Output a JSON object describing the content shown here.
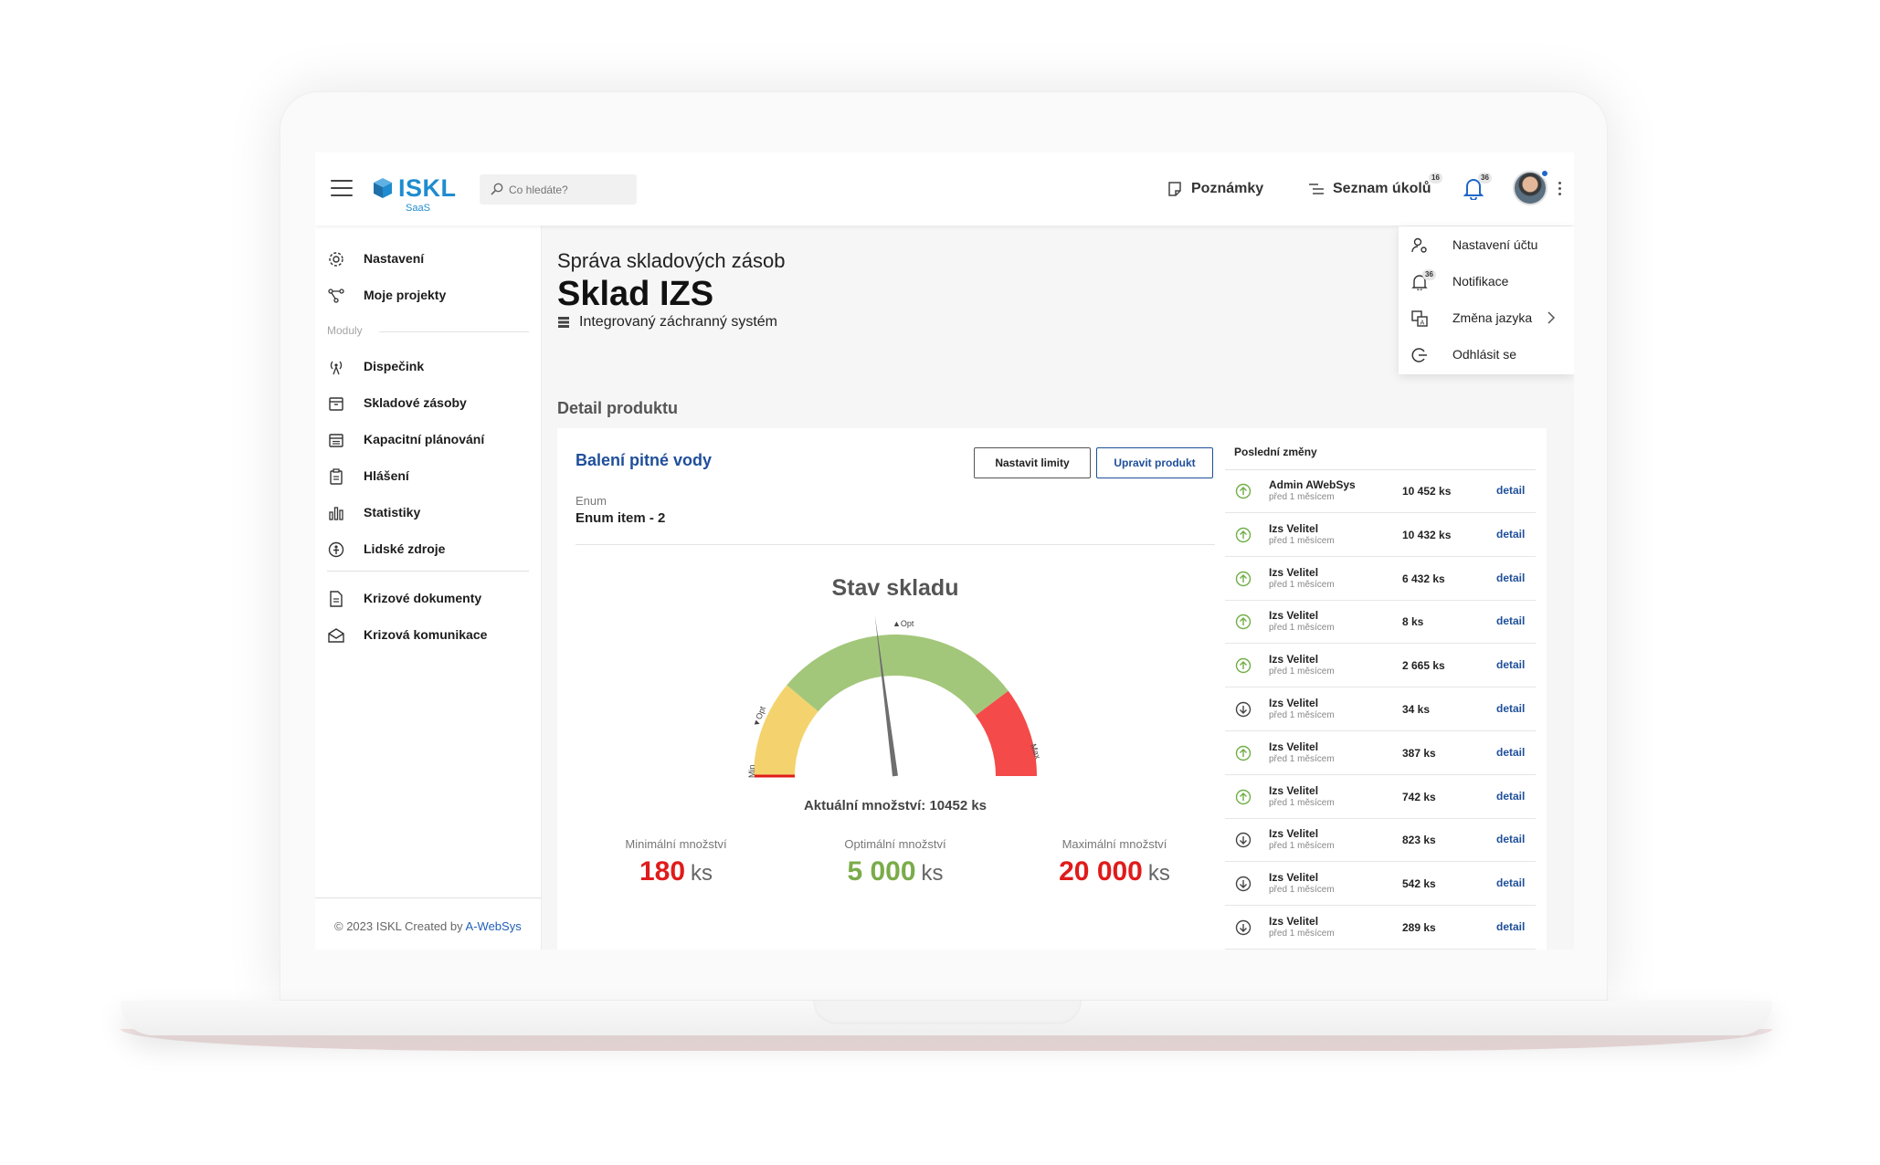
{
  "app": {
    "logo_text": "ISKL",
    "logo_sub": "SaaS",
    "brand_color": "#1f8ccf"
  },
  "search": {
    "placeholder": "Co hledáte?"
  },
  "header": {
    "notes_label": "Poznámky",
    "tasks_label": "Seznam úkolů",
    "tasks_count": "16",
    "notifications_count": "36"
  },
  "user_menu": {
    "items": [
      {
        "label": "Nastavení účtu",
        "icon": "user-settings-icon"
      },
      {
        "label": "Notifikace",
        "icon": "bell-icon",
        "badge": "36"
      },
      {
        "label": "Změna jazyka",
        "icon": "translate-icon"
      },
      {
        "label": "Odhlásit se",
        "icon": "logout-icon"
      }
    ]
  },
  "sidebar": {
    "top_items": [
      {
        "label": "Nastavení",
        "icon": "gear-icon"
      },
      {
        "label": "Moje projekty",
        "icon": "project-icon"
      }
    ],
    "section_label": "Moduly",
    "module_items": [
      {
        "label": "Dispečink",
        "icon": "antenna-icon"
      },
      {
        "label": "Skladové zásoby",
        "icon": "box-icon"
      },
      {
        "label": "Kapacitní plánování",
        "icon": "calendar-icon"
      },
      {
        "label": "Hlášení",
        "icon": "clipboard-icon"
      },
      {
        "label": "Statistiky",
        "icon": "bar-chart-icon"
      },
      {
        "label": "Lidské zdroje",
        "icon": "person-circle-icon"
      }
    ],
    "bottom_items": [
      {
        "label": "Krizové dokumenty",
        "icon": "document-icon"
      },
      {
        "label": "Krizová komunikace",
        "icon": "mail-open-icon"
      }
    ],
    "footer_text": "© 2023 ISKL   Created by ",
    "footer_link": "A-WebSys"
  },
  "page": {
    "kicker": "Správa skladových zásob",
    "title": "Sklad IZS",
    "subtitle": "Integrovaný záchranný systém",
    "section_title": "Detail produktu"
  },
  "product": {
    "name": "Balení pitné vody",
    "btn_limits": "Nastavit limity",
    "btn_edit": "Upravit produkt",
    "field_label": "Enum",
    "field_value": "Enum item - 2"
  },
  "gauge": {
    "title": "Stav skladu",
    "current_label": "Aktuální množství: 10452 ks",
    "marker_opt": "Opt",
    "marker_min": "Min",
    "marker_max": "Max",
    "needle_fraction": 0.46,
    "colors": {
      "yellow": "#f4d36e",
      "green": "#a3c77a",
      "red": "#f44a4a"
    }
  },
  "stats": [
    {
      "label": "Minimální množství",
      "value": "180",
      "unit": "ks",
      "color": "#e01b1b"
    },
    {
      "label": "Optimální množství",
      "value": "5 000",
      "unit": "ks",
      "color": "#7aac4a"
    },
    {
      "label": "Maximální množství",
      "value": "20 000",
      "unit": "ks",
      "color": "#e01b1b"
    }
  ],
  "changes": {
    "title": "Poslední změny",
    "link_label": "detail",
    "rows": [
      {
        "user": "Admin AWebSys",
        "time": "před 1 měsícem",
        "qty": "10 452 ks",
        "direction": "up"
      },
      {
        "user": "Izs Velitel",
        "time": "před 1 měsícem",
        "qty": "10 432 ks",
        "direction": "up"
      },
      {
        "user": "Izs Velitel",
        "time": "před 1 měsícem",
        "qty": "6 432 ks",
        "direction": "up"
      },
      {
        "user": "Izs Velitel",
        "time": "před 1 měsícem",
        "qty": "8 ks",
        "direction": "up"
      },
      {
        "user": "Izs Velitel",
        "time": "před 1 měsícem",
        "qty": "2 665 ks",
        "direction": "up"
      },
      {
        "user": "Izs Velitel",
        "time": "před 1 měsícem",
        "qty": "34 ks",
        "direction": "down"
      },
      {
        "user": "Izs Velitel",
        "time": "před 1 měsícem",
        "qty": "387 ks",
        "direction": "up"
      },
      {
        "user": "Izs Velitel",
        "time": "před 1 měsícem",
        "qty": "742 ks",
        "direction": "up"
      },
      {
        "user": "Izs Velitel",
        "time": "před 1 měsícem",
        "qty": "823 ks",
        "direction": "down"
      },
      {
        "user": "Izs Velitel",
        "time": "před 1 měsícem",
        "qty": "542 ks",
        "direction": "down"
      },
      {
        "user": "Izs Velitel",
        "time": "před 1 měsícem",
        "qty": "289 ks",
        "direction": "down"
      }
    ]
  }
}
